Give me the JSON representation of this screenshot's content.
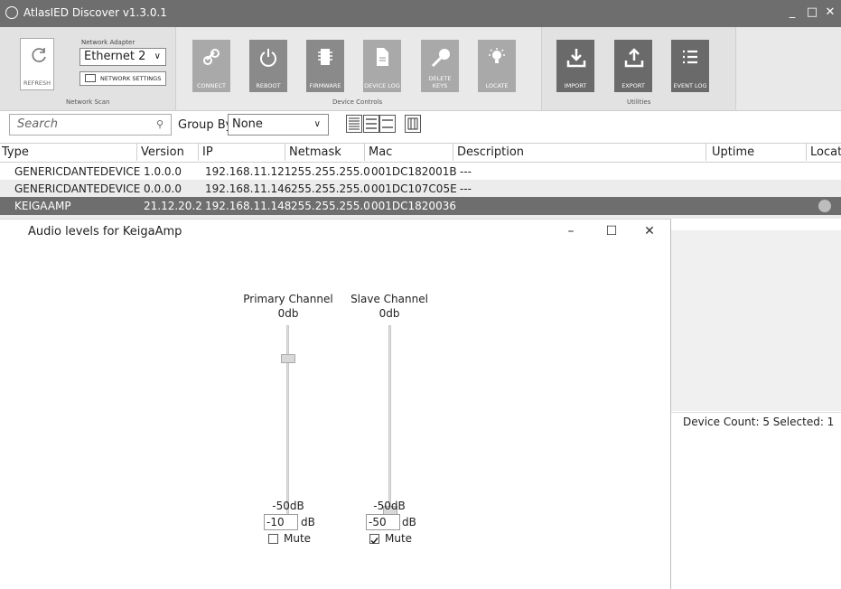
{
  "window": {
    "title": "AtlasIED Discover v1.3.0.1",
    "minimize": "_",
    "maximize": "□",
    "close": "✕"
  },
  "ribbon": {
    "network_scan": {
      "group_label": "Network Scan",
      "refresh_label": "REFRESH",
      "adapter_label": "Network Adapter",
      "adapter_value": "Ethernet 2",
      "network_settings_label": "NETWORK SETTINGS"
    },
    "device_controls": {
      "group_label": "Device Controls",
      "buttons": [
        "CONNECT",
        "REBOOT",
        "FIRMWARE",
        "DEVICE LOG",
        "DELETE KEYS",
        "LOCATE"
      ]
    },
    "utilities": {
      "group_label": "Utilities",
      "buttons": [
        "IMPORT",
        "EXPORT",
        "EVENT LOG"
      ]
    }
  },
  "search": {
    "placeholder": "Search",
    "group_by_label": "Group By",
    "group_by_value": "None"
  },
  "table": {
    "columns": [
      "Type",
      "Version",
      "IP",
      "Netmask",
      "Mac",
      "Description",
      "Uptime",
      "Locate"
    ],
    "rows": [
      {
        "type": "GENERICDANTEDEVICE",
        "version": "1.0.0.0",
        "ip": "192.168.11.121",
        "netmask": "255.255.255.0",
        "mac": "001DC182001B",
        "description": "---"
      },
      {
        "type": "GENERICDANTEDEVICE",
        "version": "0.0.0.0",
        "ip": "192.168.11.146",
        "netmask": "255.255.255.0",
        "mac": "001DC107C05E",
        "description": "---"
      },
      {
        "type": "KEIGAAMP",
        "version": "21.12.20.2",
        "ip": "192.168.11.148",
        "netmask": "255.255.255.0",
        "mac": "001DC1820036",
        "description": ""
      }
    ]
  },
  "status": {
    "text": "Device Count: 5  Selected: 1"
  },
  "dialog": {
    "title": "Audio levels for KeigaAmp",
    "primary": {
      "name": "Primary Channel",
      "level": "0db",
      "min_label": "-50dB",
      "value": "-10",
      "unit": "dB",
      "mute_label": "Mute",
      "muted": false,
      "slider_fraction": 0.8
    },
    "slave": {
      "name": "Slave Channel",
      "level": "0db",
      "min_label": "-50dB",
      "value": "-50",
      "unit": "dB",
      "mute_label": "Mute",
      "muted": true,
      "slider_fraction": 0.0
    }
  },
  "colors": {
    "selected_row": "#6e6e6e",
    "alt_row": "#ececec",
    "titlebar": "#6e6e6e"
  }
}
